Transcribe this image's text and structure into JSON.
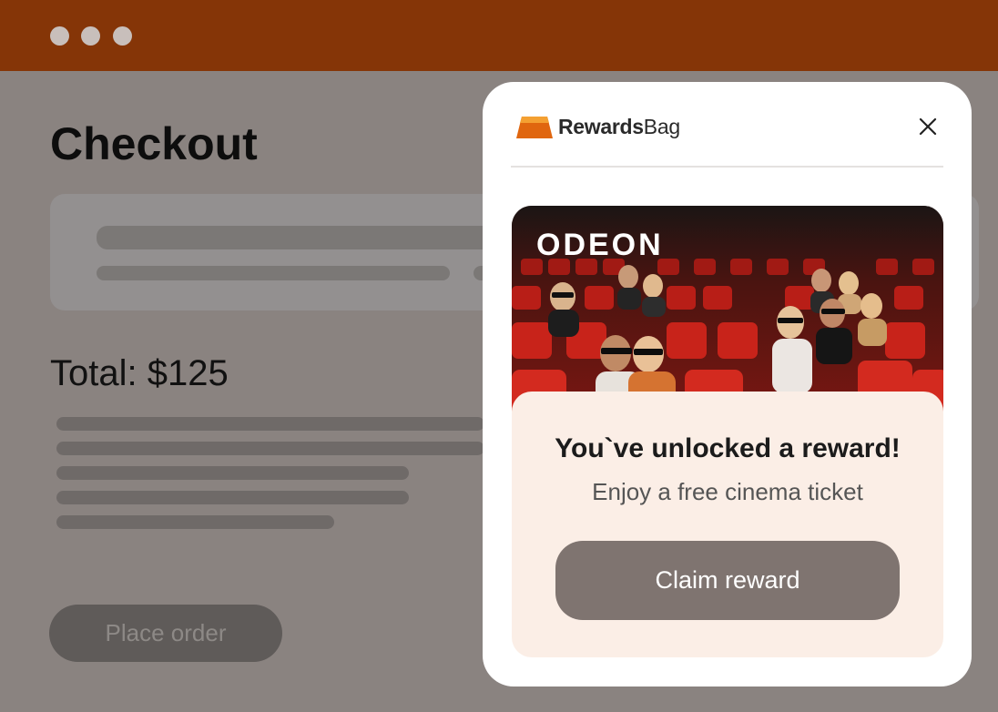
{
  "window": {
    "controls": [
      "window-dot",
      "window-dot",
      "window-dot"
    ]
  },
  "checkout": {
    "title": "Checkout",
    "total": "Total: $125",
    "place_order_label": "Place order"
  },
  "modal": {
    "brand_logo_bold": "Rewards",
    "brand_logo_regular": "Bag",
    "partner_brand": "ODEON",
    "headline": "You`ve unlocked a reward!",
    "subtitle": "Enjoy a free cinema ticket",
    "claim_label": "Claim reward"
  },
  "colors": {
    "titlebar": "#853507",
    "overlay": "#8a8380",
    "modal_panel": "#fbeee6",
    "claim_button": "#7f7470",
    "logo_accent": "#e0660f"
  }
}
